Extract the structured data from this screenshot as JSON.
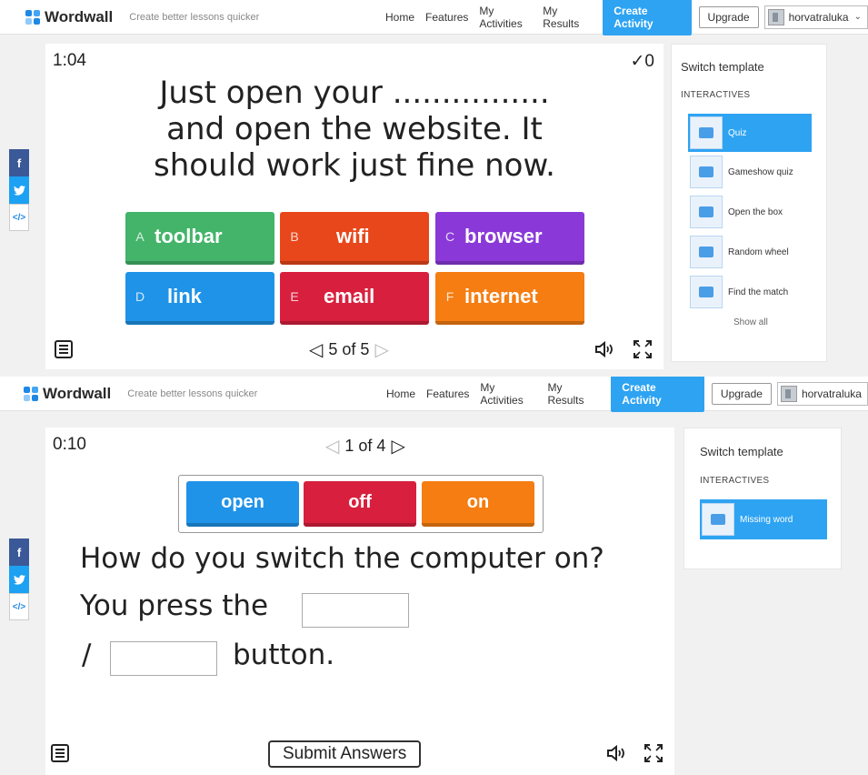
{
  "header": {
    "brand": "Wordwall",
    "tagline": "Create better lessons quicker",
    "nav": [
      "Home",
      "Features",
      "My Activities",
      "My Results"
    ],
    "create_label": "Create Activity",
    "upgrade_label": "Upgrade",
    "username": "horvatraluka",
    "brand_color": "#2ea3f2"
  },
  "social": {
    "facebook": "f",
    "twitter": "🐦",
    "embed": "</>"
  },
  "quiz": {
    "timer": "1:04",
    "score_mark": "✓",
    "score": "0",
    "question_lines": [
      "Just open your ................",
      "and open the website. It",
      "should work just fine now."
    ],
    "answers": [
      {
        "letter": "A",
        "text": "toolbar",
        "color": "#43b469"
      },
      {
        "letter": "B",
        "text": "wifi",
        "color": "#e8471b"
      },
      {
        "letter": "C",
        "text": "browser",
        "color": "#8a39d8"
      },
      {
        "letter": "D",
        "text": "link",
        "color": "#1f93e8"
      },
      {
        "letter": "E",
        "text": "email",
        "color": "#d8203e"
      },
      {
        "letter": "F",
        "text": "internet",
        "color": "#f57d12"
      }
    ],
    "pager": "5 of 5",
    "sidebar": {
      "title": "Switch template",
      "category": "INTERACTIVES",
      "templates": [
        "Quiz",
        "Gameshow quiz",
        "Open the box",
        "Random wheel",
        "Find the match"
      ],
      "active_template": "Quiz",
      "show_all": "Show all"
    }
  },
  "missing_word": {
    "timer": "0:10",
    "pager": "1 of 4",
    "words": [
      {
        "text": "open",
        "color": "#1f93e8"
      },
      {
        "text": "off",
        "color": "#d8203e"
      },
      {
        "text": "on",
        "color": "#f57d12"
      }
    ],
    "line1": "How do you switch the computer on?",
    "line2": "You press the",
    "line3_prefix": "/",
    "line3_suffix": "button.",
    "submit_label": "Submit Answers",
    "sidebar": {
      "title": "Switch template",
      "category": "INTERACTIVES",
      "templates": [
        "Missing word"
      ],
      "active_template": "Missing word"
    }
  }
}
